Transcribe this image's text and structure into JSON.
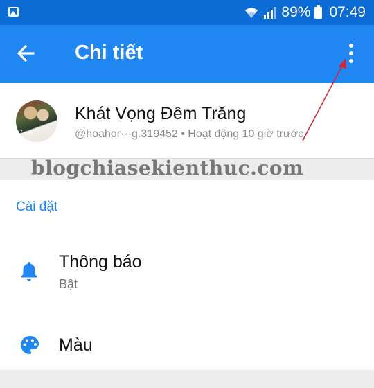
{
  "status_bar": {
    "battery": "89%",
    "time": "07:49"
  },
  "app_bar": {
    "title": "Chi tiết"
  },
  "profile": {
    "name": "Khát Vọng Đêm Trăng",
    "subtitle": "@hoahor···g.319452 • Hoạt động 10 giờ trước",
    "avatar_caption": "Love"
  },
  "watermark": "blogchiasekienthuc.com",
  "settings": {
    "section_label": "Cài đặt",
    "items": [
      {
        "label": "Thông báo",
        "value": "Bật",
        "icon": "bell-icon"
      },
      {
        "label": "Màu",
        "icon": "palette-icon"
      }
    ]
  },
  "colors": {
    "status_bar": "#0d6bd6",
    "app_bar": "#1f86f2",
    "accent": "#1f86f2",
    "annotation": "#d0263a"
  }
}
